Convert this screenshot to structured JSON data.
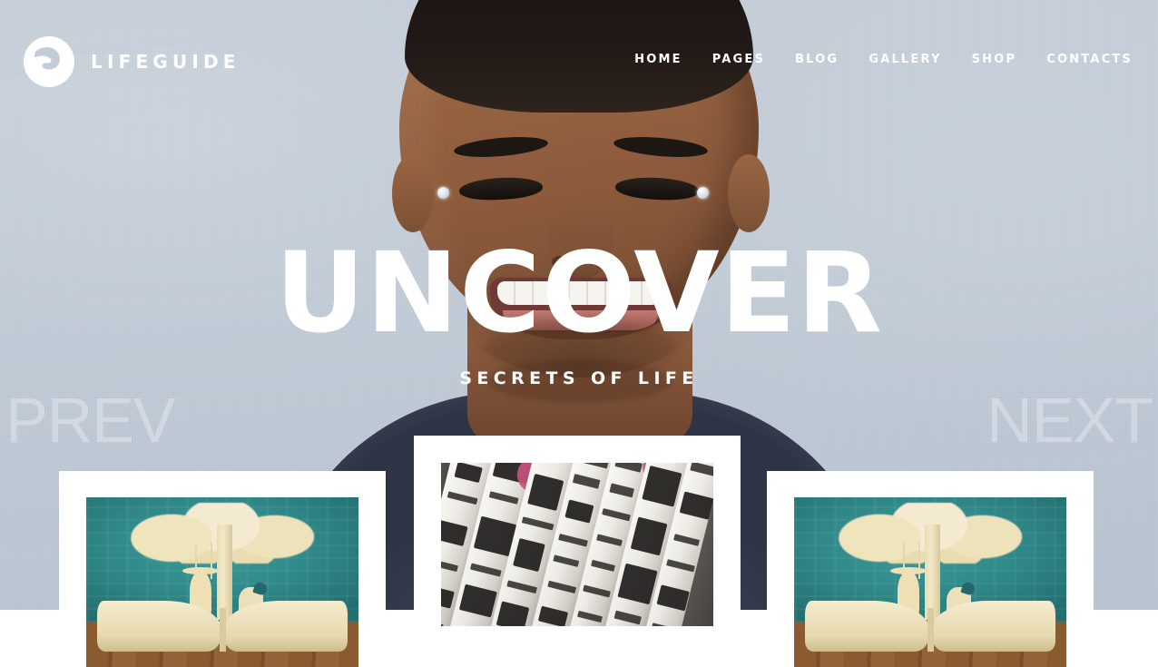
{
  "header": {
    "brand_name": "LIFEGUIDE",
    "logo_icon": "lifeguide-logo-icon",
    "nav": [
      {
        "label": "HOME"
      },
      {
        "label": "PAGES"
      },
      {
        "label": "BLOG"
      },
      {
        "label": "GALLERY"
      },
      {
        "label": "SHOP"
      },
      {
        "label": "CONTACTS"
      }
    ]
  },
  "hero": {
    "headline": "UNCOVER",
    "subheadline": "SECRETS OF LIFE",
    "prev_label": "PREV",
    "next_label": "NEXT",
    "background_image_alt": "Smiling man with stud earrings against a blue-gray painted wall",
    "wall_color": "#c2ccd8",
    "shirt_color": "#343b4d",
    "text_color": "#ffffff",
    "arrow_color": "rgba(255,255,255,0.30)"
  },
  "cards": [
    {
      "position": "left",
      "image_alt": "Paper-cut art of a tree with children on a swing rising from an open book",
      "accent_color": "#2f8887"
    },
    {
      "position": "center",
      "image_alt": "Rolled-up newspapers stacked side by side",
      "accent_color": "#8f8c87"
    },
    {
      "position": "right",
      "image_alt": "Paper-cut art of a tree with children on a swing rising from an open book",
      "accent_color": "#2f8887"
    }
  ],
  "footer": {
    "band_color": "#ffffff"
  }
}
